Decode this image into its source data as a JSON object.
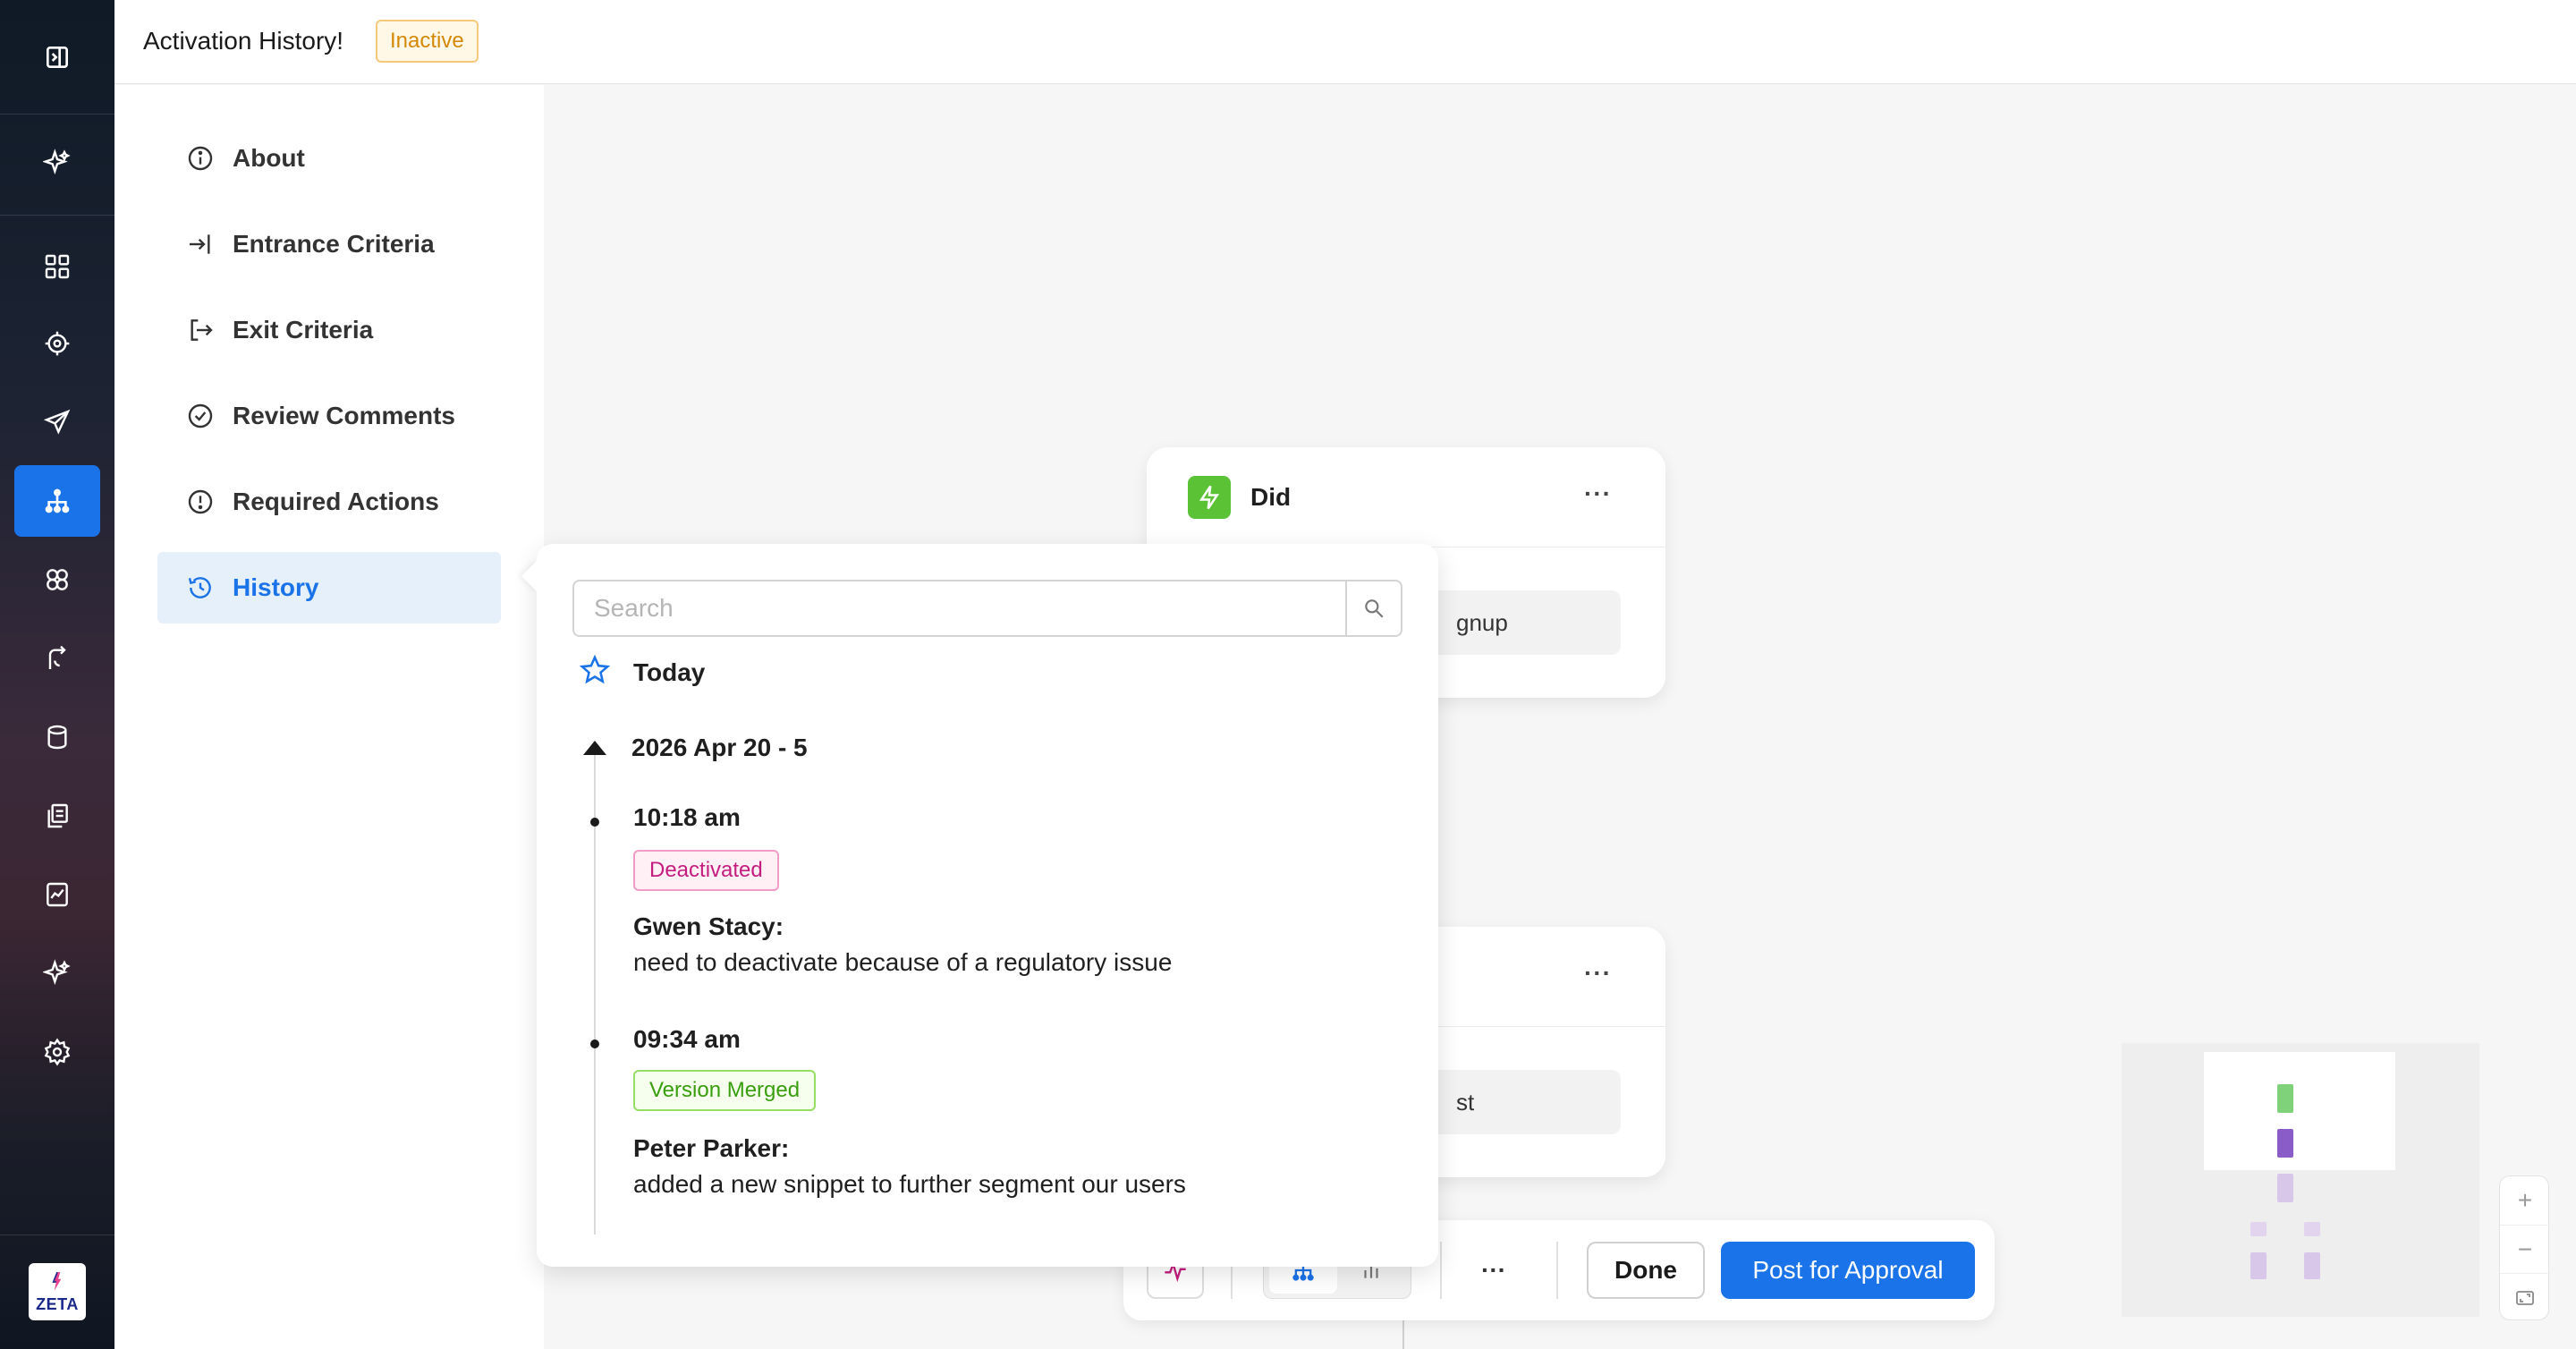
{
  "header": {
    "title": "Activation History!",
    "status_badge": "Inactive"
  },
  "rail": {
    "icons": [
      "sidebar-toggle-icon",
      "sparkle-icon",
      "dashboard-icon",
      "target-icon",
      "send-icon",
      "hierarchy-icon",
      "segments-icon",
      "journey-icon",
      "database-icon",
      "documents-icon",
      "reports-icon",
      "ai-sparkle-icon",
      "settings-icon"
    ],
    "active": "hierarchy-icon",
    "logo_text": "ZETA"
  },
  "sidenav": {
    "items": [
      {
        "label": "About",
        "icon": "info-icon"
      },
      {
        "label": "Entrance Criteria",
        "icon": "enter-icon"
      },
      {
        "label": "Exit Criteria",
        "icon": "exit-icon"
      },
      {
        "label": "Review Comments",
        "icon": "check-circle-icon"
      },
      {
        "label": "Required Actions",
        "icon": "alert-circle-icon"
      },
      {
        "label": "History",
        "icon": "history-icon"
      }
    ],
    "active": "History"
  },
  "canvas": {
    "node1": {
      "title": "Did",
      "more": "···",
      "pill": "gnup"
    },
    "node2": {
      "more": "···",
      "pill": "st"
    }
  },
  "toolbar": {
    "more_label": "···",
    "done_label": "Done",
    "post_label": "Post for Approval"
  },
  "minimap": {
    "colors": [
      "#7fd17a",
      "#8a5cc7",
      "#d9c7ea"
    ]
  },
  "zoom": {
    "in_label": "+",
    "out_label": "−"
  },
  "history": {
    "search_placeholder": "Search",
    "today_label": "Today",
    "group_label": "2026 Apr 20 - 5",
    "entries": [
      {
        "time": "10:18 am",
        "tag": "Deactivated",
        "author": "Gwen Stacy:",
        "comment": "need to deactivate because of a regulatory issue"
      },
      {
        "time": "09:34 am",
        "tag": "Version Merged",
        "author": "Peter Parker:",
        "comment": "added a new snippet to further segment our users"
      }
    ]
  },
  "colors": {
    "accent": "#1a73e8",
    "warning": "#d48806",
    "deactivated": "#c41d7f",
    "merged": "#389e0d"
  }
}
